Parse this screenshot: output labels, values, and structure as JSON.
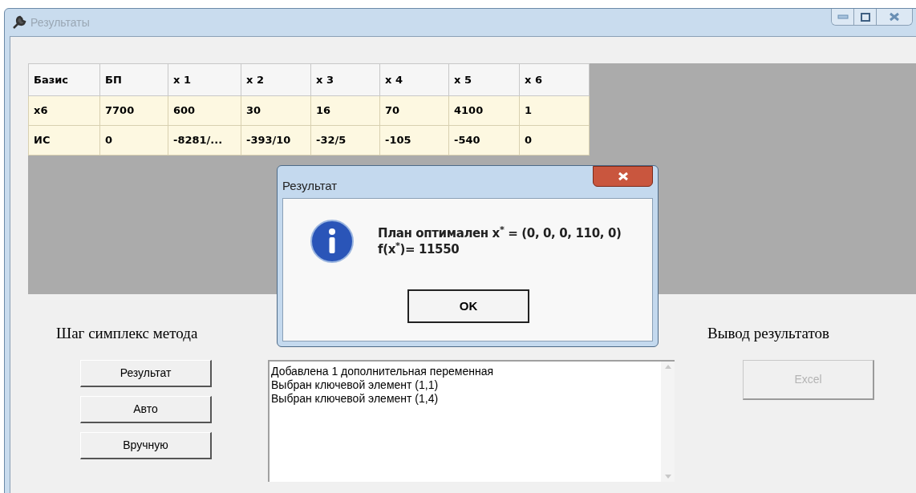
{
  "window": {
    "title": "Результаты"
  },
  "table": {
    "columns": [
      "Базис",
      "БП",
      "x 1",
      "x 2",
      "x 3",
      "x 4",
      "x 5",
      "x 6"
    ],
    "rows": [
      [
        "x6",
        "7700",
        "600",
        "30",
        "16",
        "70",
        "4100",
        "1"
      ],
      [
        "ИС",
        "0",
        "-8281/...",
        "-393/10",
        "-32/5",
        "-105",
        "-540",
        "0"
      ]
    ]
  },
  "dialog": {
    "title": "Результат",
    "message": [
      "План оптимален x$^{*}$ = (0, 0, 0, 110, 0)",
      "f(x$^{*}$)= 11550"
    ],
    "button": "OK"
  },
  "step_section": {
    "title": "Шаг симплекс метода",
    "buttons": [
      {
        "label": "Результат",
        "disabled": false
      },
      {
        "label": "Авто",
        "disabled": false
      },
      {
        "label": "Вручную",
        "disabled": false
      }
    ]
  },
  "log": [
    "Добавлена 1 дополнительная переменная",
    "Выбран ключевой элемент (1,1)",
    "Выбран ключевой элемент (1,4)"
  ],
  "output_section": {
    "title": "Вывод результатов",
    "buttons": [
      {
        "label": "Excel",
        "disabled": true
      }
    ]
  }
}
